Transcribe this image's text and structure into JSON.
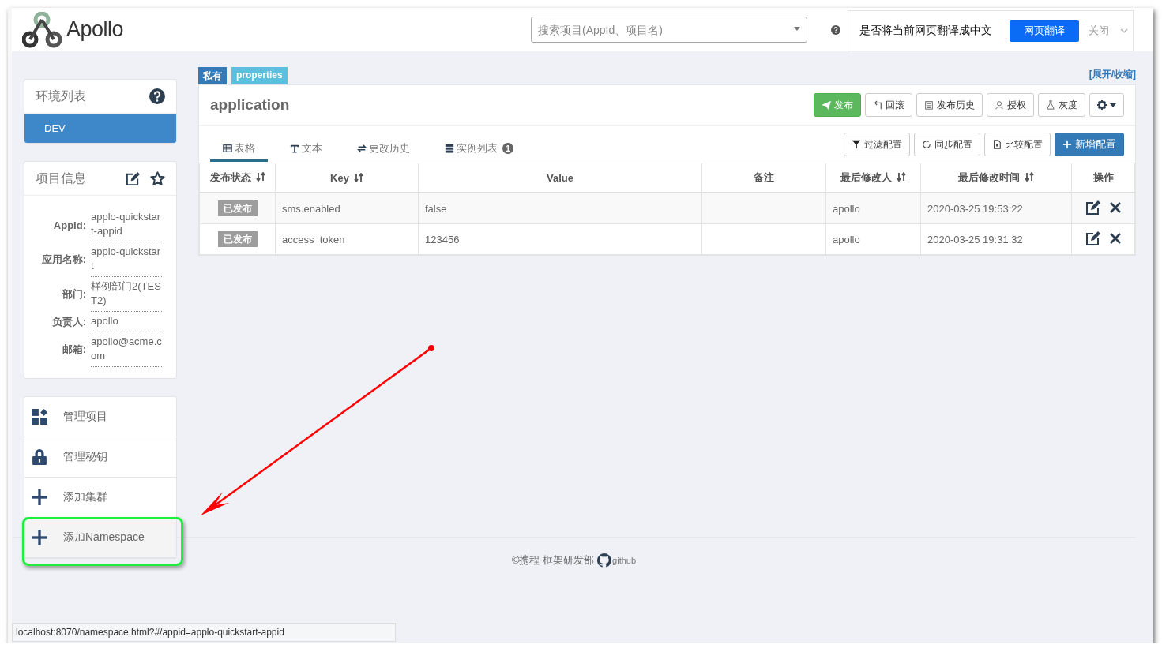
{
  "header": {
    "logo": "Apollo",
    "search": {
      "placeholder": "搜索项目(AppId、项目名)"
    }
  },
  "translate_bar": {
    "prompt": "是否将当前网页翻译成中文",
    "translate_button": "网页翻译",
    "close": "关闭"
  },
  "env_panel": {
    "title": "环境列表",
    "envs": [
      {
        "label": "DEV",
        "selected": true
      }
    ]
  },
  "project_info": {
    "title": "项目信息",
    "fields": [
      {
        "label": "AppId:",
        "value": "applo-quickstart-appid"
      },
      {
        "label": "应用名称:",
        "value": "applo-quickstart"
      },
      {
        "label": "部门:",
        "value": "样例部门2(TEST2)"
      },
      {
        "label": "负责人:",
        "value": "apollo"
      },
      {
        "label": "邮箱:",
        "value": "apollo@acme.com"
      }
    ]
  },
  "menu": [
    {
      "kind": "grid",
      "label": "管理项目",
      "hovered": false,
      "highlighted": false
    },
    {
      "kind": "lock",
      "label": "管理秘钥",
      "hovered": false,
      "highlighted": false
    },
    {
      "kind": "plus",
      "label": "添加集群",
      "hovered": false,
      "highlighted": false
    },
    {
      "kind": "plus",
      "label": "添加Namespace",
      "hovered": true,
      "highlighted": true
    }
  ],
  "namespace": {
    "tags": [
      {
        "kind": "scope",
        "label": "私有"
      },
      {
        "kind": "format",
        "label": "properties"
      }
    ],
    "toggle": "[展开/收缩]",
    "name": "application",
    "actions": [
      {
        "kind": "publish",
        "label": "发布"
      },
      {
        "kind": "rollback",
        "label": "回滚"
      },
      {
        "kind": "history",
        "label": "发布历史"
      },
      {
        "kind": "grant",
        "label": "授权"
      },
      {
        "kind": "gray",
        "label": "灰度"
      },
      {
        "kind": "settings"
      }
    ],
    "tabs": [
      {
        "kind": "table",
        "label": "表格",
        "selected": true
      },
      {
        "kind": "text",
        "label": "文本",
        "selected": false
      },
      {
        "kind": "history",
        "label": "更改历史",
        "selected": false
      },
      {
        "kind": "instances",
        "label": "实例列表",
        "badge": "1",
        "selected": false
      }
    ],
    "tools": [
      {
        "kind": "filter",
        "label": "过滤配置"
      },
      {
        "kind": "sync",
        "label": "同步配置"
      },
      {
        "kind": "compare",
        "label": "比较配置"
      },
      {
        "kind": "add",
        "label": "新增配置"
      }
    ],
    "table": {
      "columns": [
        {
          "label": "发布状态",
          "sortable": true
        },
        {
          "label": "Key",
          "sortable": true
        },
        {
          "label": "Value",
          "sortable": false
        },
        {
          "label": "备注",
          "sortable": false
        },
        {
          "label": "最后修改人",
          "sortable": true
        },
        {
          "label": "最后修改时间",
          "sortable": true
        },
        {
          "label": "操作",
          "sortable": false
        }
      ],
      "rows": [
        {
          "status": "已发布",
          "key": "sms.enabled",
          "value": "false",
          "modified_by": "apollo",
          "modified_at": "2020-03-25 19:53:22"
        },
        {
          "status": "已发布",
          "key": "access_token",
          "value": "123456",
          "modified_by": "apollo",
          "modified_at": "2020-03-25 19:31:32"
        }
      ]
    }
  },
  "footer": {
    "text": "©携程 框架研发部",
    "link": "github"
  },
  "status_url": "localhost:8070/namespace.html?#/appid=applo-quickstart-appid"
}
